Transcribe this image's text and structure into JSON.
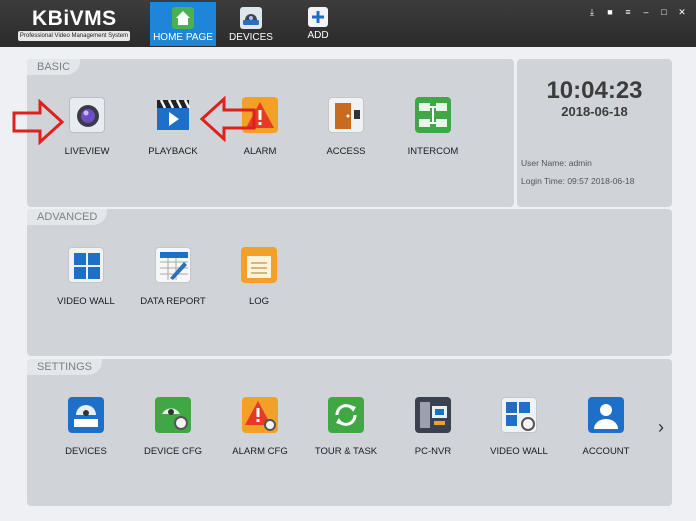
{
  "app": {
    "logo": "KBiVMS",
    "logo_subtitle": "Professional Video Management System"
  },
  "nav": {
    "tabs": [
      {
        "label": "HOME PAGE",
        "active": true,
        "icon": "home-icon"
      },
      {
        "label": "DEVICES",
        "active": false,
        "icon": "device-camera-icon"
      },
      {
        "label": "ADD",
        "active": false,
        "icon": "plus-icon"
      }
    ]
  },
  "window_controls": [
    "download-icon",
    "lock-icon",
    "menu-icon",
    "minimize-icon",
    "restore-icon",
    "close-icon"
  ],
  "basic": {
    "header": "BASIC",
    "tiles": [
      {
        "label": "LIVEVIEW",
        "icon": "camera-lens-icon"
      },
      {
        "label": "PLAYBACK",
        "icon": "clapperboard-play-icon"
      },
      {
        "label": "ALARM",
        "icon": "warning-icon"
      },
      {
        "label": "ACCESS",
        "icon": "door-icon"
      },
      {
        "label": "INTERCOM",
        "icon": "intercom-icon"
      }
    ]
  },
  "clock": {
    "time": "10:04:23",
    "date": "2018-06-18",
    "user_name_label": "User Name:",
    "user_name": "admin",
    "login_time_label": "Login Time:",
    "login_time": "09:57 2018-06-18"
  },
  "advanced": {
    "header": "ADVANCED",
    "tiles": [
      {
        "label": "VIDEO WALL",
        "icon": "video-wall-icon"
      },
      {
        "label": "DATA REPORT",
        "icon": "report-icon"
      },
      {
        "label": "LOG",
        "icon": "log-icon"
      }
    ]
  },
  "settings": {
    "header": "SETTINGS",
    "tiles": [
      {
        "label": "DEVICES",
        "icon": "dome-camera-icon"
      },
      {
        "label": "DEVICE CFG",
        "icon": "camera-gear-icon"
      },
      {
        "label": "ALARM CFG",
        "icon": "warning-gear-icon"
      },
      {
        "label": "TOUR & TASK",
        "icon": "refresh-icon"
      },
      {
        "label": "PC-NVR",
        "icon": "pc-nvr-icon"
      },
      {
        "label": "VIDEO WALL",
        "icon": "video-wall-gear-icon"
      },
      {
        "label": "ACCOUNT",
        "icon": "user-icon"
      }
    ]
  },
  "colors": {
    "active_tab": "#1e86d6",
    "annotation_arrow": "#e0201c",
    "panel": "#d0d4d9"
  }
}
